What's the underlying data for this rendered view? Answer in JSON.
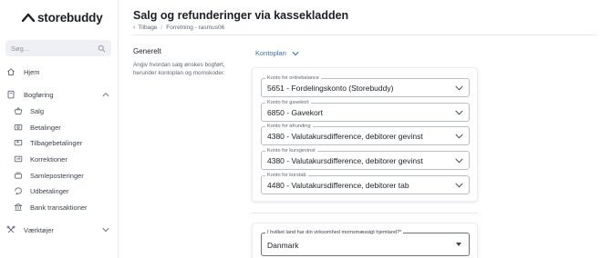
{
  "brand": {
    "name": "storebuddy",
    "logo_icon": "storebuddy-chevron-logo"
  },
  "sidebar": {
    "search_placeholder": "Søg...",
    "items": [
      {
        "label": "Hjem",
        "icon": "home-icon"
      },
      {
        "label": "Bogføring",
        "icon": "book-icon",
        "expanded": true
      },
      {
        "label": "Salg",
        "icon": "basket-icon"
      },
      {
        "label": "Betalinger",
        "icon": "payment-icon"
      },
      {
        "label": "Tilbagebetalinger",
        "icon": "refund-icon"
      },
      {
        "label": "Korrektioner",
        "icon": "correction-icon"
      },
      {
        "label": "Samleposteringer",
        "icon": "stack-icon"
      },
      {
        "label": "Udbetalinger",
        "icon": "payout-icon"
      },
      {
        "label": "Bank transaktioner",
        "icon": "bank-icon"
      },
      {
        "label": "Værktøjer",
        "icon": "tools-icon",
        "expanded": false
      }
    ]
  },
  "header": {
    "title": "Salg og refunderinger via kassekladden",
    "breadcrumb": {
      "back": "Tilbage",
      "path": "Forretning - rasmus06"
    }
  },
  "section": {
    "title": "Generelt",
    "description": "Angiv hvordan salg ønskes bogført, herunder kontoplan og momskoder.",
    "kontoplan_label": "Kontoplan"
  },
  "fields": [
    {
      "label": "Konto for ordrebalance",
      "value": "5651 - Fordelingskonto (Storebuddy)"
    },
    {
      "label": "Konto for gavekort",
      "value": "6850 - Gavekort"
    },
    {
      "label": "Konto for afrunding",
      "value": "4380 - Valutakursdifference, debitorer gevinst"
    },
    {
      "label": "Konto for kursgevinst",
      "value": "4380 - Valutakursdifference, debitorer gevinst"
    },
    {
      "label": "Konto for kurstab",
      "value": "4480 - Valutakursdifference, debitorer tab"
    }
  ],
  "country": {
    "label": "I hvilket land har din virksomhed momsmæssigt hjemland?*",
    "value": "Danmark"
  },
  "colors": {
    "accent": "#3a6fb0",
    "text": "#1c1f26",
    "muted": "#5f6674",
    "border": "#b9bec7"
  }
}
